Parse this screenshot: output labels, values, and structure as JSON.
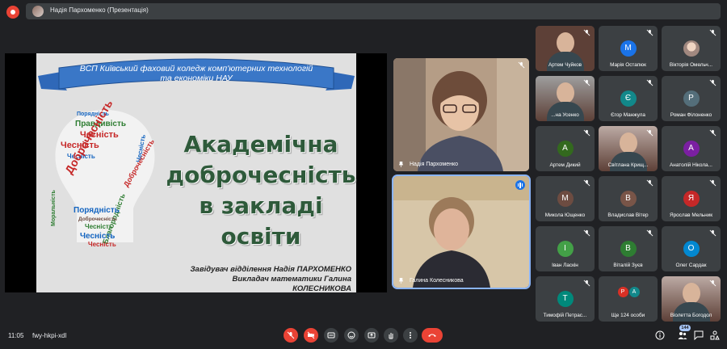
{
  "header": {
    "presenter_label": "Надія Пархоменко (Презентація)"
  },
  "slide": {
    "banner_line1": "ВСП Київський фаховий коледж комп'ютерних технологій",
    "banner_line2": "та економіки НАУ",
    "title_line1": "Академічна",
    "title_line2": "доброчесність",
    "title_line3": "в закладі освіти",
    "footer_line1": "Завідувач відділення Надія ПАРХОМЕНКО",
    "footer_line2": "Викладач математики Галина КОЛЕСНИКОВА",
    "cloud_words": [
      "Порядність",
      "Правдивість",
      "Чесність",
      "Чесність",
      "Чесність",
      "Доброчесність",
      "Благородність",
      "Доброчесність",
      "Порядність",
      "Доброчесність",
      "Чесність",
      "Чесність",
      "Чесність",
      "Моральність",
      "Чесність"
    ]
  },
  "big_tiles": [
    {
      "name": "Надія Пархоменко"
    },
    {
      "name": "Галина Колесникова"
    }
  ],
  "participants": [
    {
      "name": "Артем Чуйков",
      "initial": "",
      "color": "#5d4037",
      "video": true
    },
    {
      "name": "Марія Остапюк",
      "initial": "М",
      "color": "#1a73e8"
    },
    {
      "name": "Вікторія Омельч...",
      "initial": "",
      "color": "#d7ccc8",
      "photo": true
    },
    {
      "name": "...на Усенко",
      "initial": "",
      "color": "#9e9e9e",
      "video": true
    },
    {
      "name": "Єгор Манжула",
      "initial": "Є",
      "color": "#12888a"
    },
    {
      "name": "Роман Філоненко",
      "initial": "Р",
      "color": "#546e7a"
    },
    {
      "name": "Артем Дикий",
      "initial": "А",
      "color": "#33691e"
    },
    {
      "name": "Світлана Крищ...",
      "initial": "",
      "color": "#bcaaa4",
      "video": true
    },
    {
      "name": "Анатолій Нікола...",
      "initial": "А",
      "color": "#7b1fa2"
    },
    {
      "name": "Микола Ющенко",
      "initial": "М",
      "color": "#6d4c41"
    },
    {
      "name": "Владислав Вітер",
      "initial": "В",
      "color": "#795548"
    },
    {
      "name": "Ярослав Мельник",
      "initial": "Я",
      "color": "#c62828"
    },
    {
      "name": "Іван Ласкін",
      "initial": "І",
      "color": "#43a047"
    },
    {
      "name": "Віталій Зуєв",
      "initial": "В",
      "color": "#2e7d32"
    },
    {
      "name": "Олег Сардак",
      "initial": "О",
      "color": "#0288d1"
    },
    {
      "name": "Тимофій Петрас...",
      "initial": "Т",
      "color": "#00897b"
    },
    {
      "name": "Ще 124 особи",
      "initial": "Р",
      "initial2": "А",
      "color": "#d93025",
      "color2": "#12888a",
      "group": true
    },
    {
      "name": "Віолетта Богодол",
      "initial": "",
      "color": "#bcaaa4",
      "video": true
    }
  ],
  "footer": {
    "time": "11:05",
    "meeting_code": "fwy-hkpi-xdl",
    "participant_count": "144"
  },
  "colors": {
    "background": "#202124",
    "tile": "#3c4043",
    "danger": "#ea4335",
    "banner": "#3a77c7"
  }
}
